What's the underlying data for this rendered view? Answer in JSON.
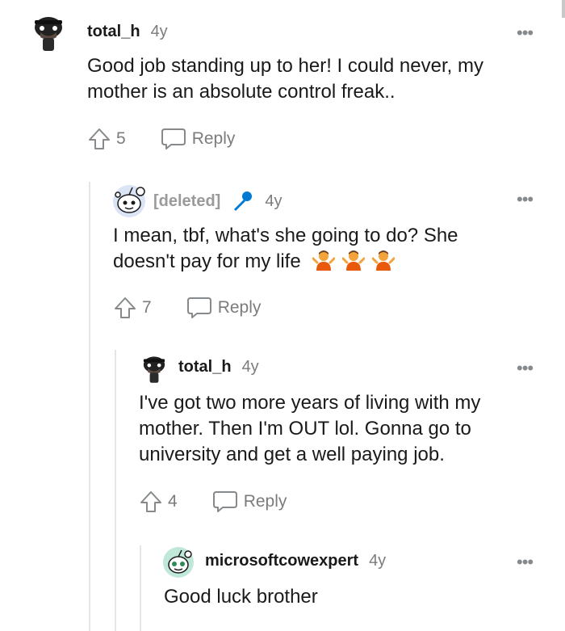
{
  "comments": [
    {
      "username": "total_h",
      "age": "4y",
      "more": "•••",
      "body_lines": [
        "Good job standing up to her! I could never, my",
        "mother is an absolute control freak.."
      ],
      "votes": "5",
      "reply_label": "Reply"
    },
    {
      "username": "[deleted]",
      "age": "4y",
      "more": "•••",
      "body_lines": [
        "I mean, tbf, what's she going to do? She",
        "doesn't pay for my life"
      ],
      "emoji_count": 3,
      "votes": "7",
      "reply_label": "Reply"
    },
    {
      "username": "total_h",
      "age": "4y",
      "more": "•••",
      "body_lines": [
        "I've got two more years of living with my",
        "mother. Then I'm OUT lol. Gonna go to",
        "university and get a well paying job."
      ],
      "votes": "4",
      "reply_label": "Reply"
    },
    {
      "username": "microsoftcowexpert",
      "age": "4y",
      "more": "•••",
      "body_lines": [
        "Good luck brother"
      ]
    }
  ],
  "icons": {
    "upvote": "upvote-arrow-icon",
    "reply": "speech-bubble-icon",
    "mic": "microphone-icon",
    "emoji": "person-shrugging-emoji",
    "more": "more-options-icon"
  },
  "colors": {
    "text": "#1a1a1b",
    "meta": "#7c7c7c",
    "deleted": "#9a9a9a",
    "mic": "#0079d3",
    "emoji_skin": "#f2a33a",
    "emoji_shirt": "#e8590c",
    "thread_line": "#e5e5e5"
  }
}
